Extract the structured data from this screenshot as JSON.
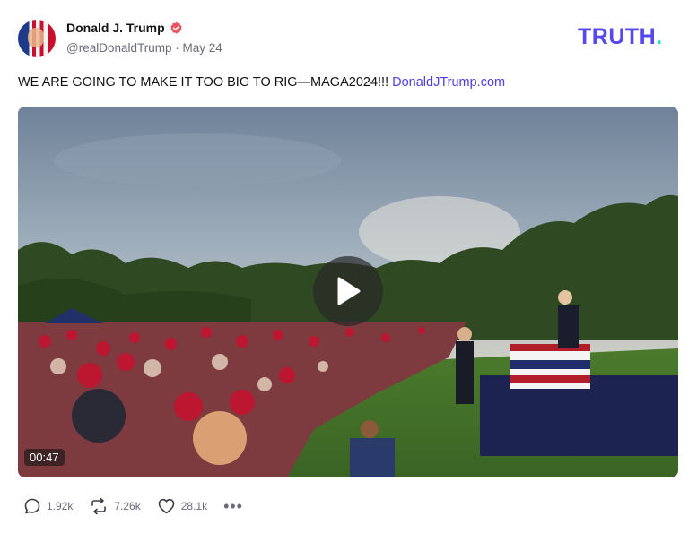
{
  "author": {
    "display_name": "Donald J. Trump",
    "handle": "@realDonaldTrump",
    "date": "May 24",
    "meta_separator": " · ",
    "verified_icon": "verified-badge-icon"
  },
  "brand": {
    "word": "TRUTH",
    "dot": ".",
    "color": "#5448ee",
    "dot_color": "#25d9c8"
  },
  "post": {
    "text": "WE ARE GOING TO MAKE IT TOO BIG TO RIG—MAGA2024!!! ",
    "link_text": "DonaldJTrump.com"
  },
  "media": {
    "type": "video",
    "duration": "00:47",
    "play_icon": "play-icon"
  },
  "actions": {
    "replies": "1.92k",
    "retruths": "7.26k",
    "likes": "28.1k",
    "more": "•••"
  },
  "colors": {
    "link": "#4d3fe6",
    "muted": "#6b6b7b",
    "verified": "#e8545f"
  }
}
